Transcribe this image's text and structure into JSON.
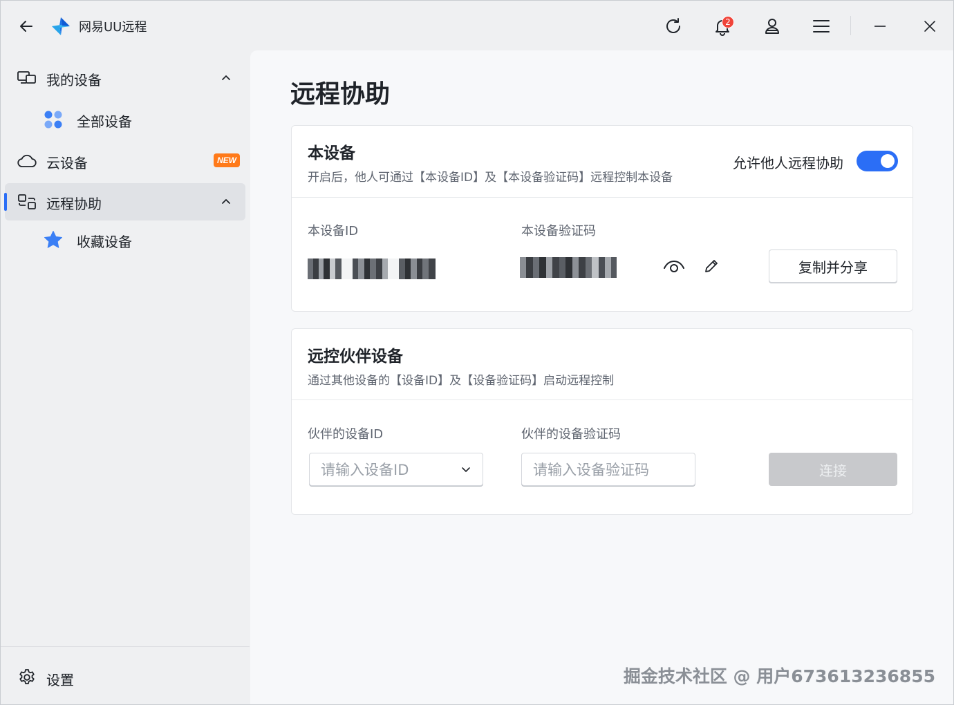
{
  "app": {
    "title": "网易UU远程",
    "notification_count": "2"
  },
  "sidebar": {
    "items": [
      {
        "label": "我的设备"
      },
      {
        "label": "全部设备"
      },
      {
        "label": "云设备",
        "badge": "NEW"
      },
      {
        "label": "远程协助"
      },
      {
        "label": "收藏设备"
      }
    ],
    "settings_label": "设置"
  },
  "main": {
    "title": "远程协助",
    "this_device": {
      "title": "本设备",
      "description": "开启后，他人可通过【本设备ID】及【本设备验证码】远程控制本设备",
      "toggle_label": "允许他人远程协助",
      "toggle_on": true,
      "id_label": "本设备ID",
      "code_label": "本设备验证码",
      "copy_share_label": "复制并分享"
    },
    "partner": {
      "title": "远控伙伴设备",
      "description": "通过其他设备的【设备ID】及【设备验证码】启动远程控制",
      "id_label": "伙伴的设备ID",
      "code_label": "伙伴的设备验证码",
      "id_placeholder": "请输入设备ID",
      "code_placeholder": "请输入设备验证码",
      "connect_label": "连接"
    }
  },
  "watermark": "掘金技术社区 @ 用户673613236855",
  "colors": {
    "accent": "#2b6ef6",
    "new_badge": "#ff7a1a",
    "notification_badge": "#f0443a"
  }
}
